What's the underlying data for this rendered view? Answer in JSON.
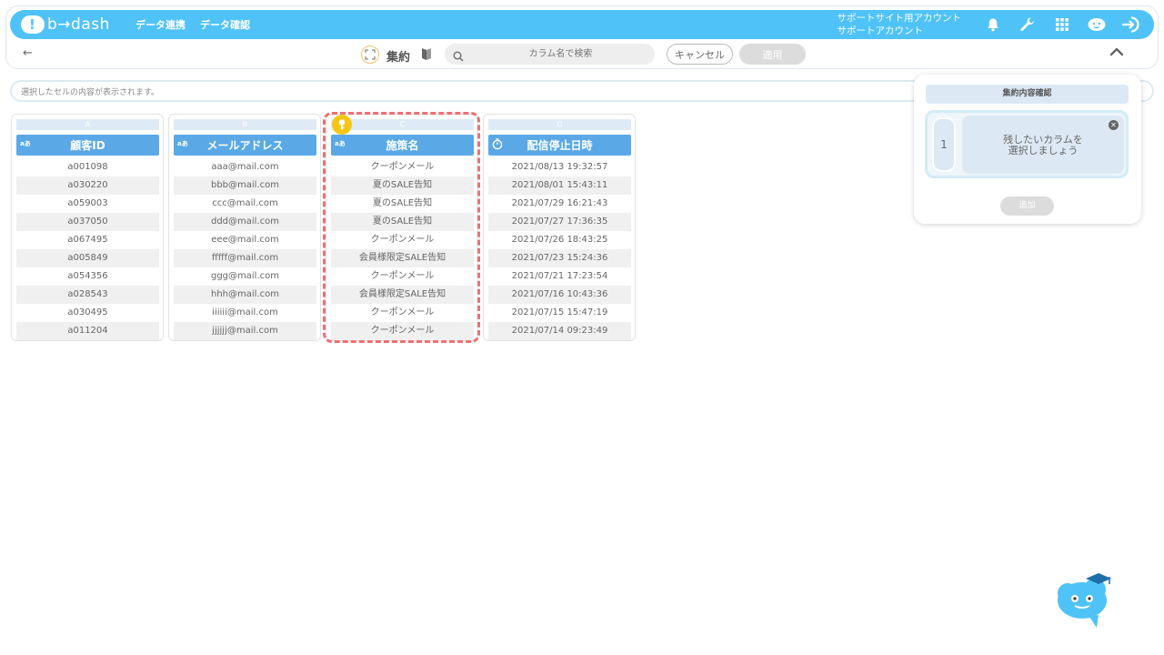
{
  "nav": {
    "logo_text": "b→dash",
    "links": [
      "データ連携",
      "データ確認"
    ],
    "account_line1": "サポートサイト用アカウント",
    "account_line2": "サポートアカウント",
    "icons": [
      "bell-icon",
      "wrench-icon",
      "grid-icon",
      "user-icon",
      "logout-icon"
    ],
    "brand_color": "#4fc3f7"
  },
  "toolbar": {
    "title": "集約",
    "search_placeholder": "カラム名で検索",
    "cancel_label": "キャンセル",
    "apply_label": "適用"
  },
  "cellbar": {
    "placeholder": "選択したセルの内容が表示されます。"
  },
  "columns": [
    {
      "letter": "A",
      "type": "aあ",
      "name": "顧客ID",
      "values": [
        "a001098",
        "a030220",
        "a059003",
        "a037050",
        "a067495",
        "a005849",
        "a054356",
        "a028543",
        "a030495",
        "a011204"
      ]
    },
    {
      "letter": "B",
      "type": "aあ",
      "name": "メールアドレス",
      "values": [
        "aaa@mail.com",
        "bbb@mail.com",
        "ccc@mail.com",
        "ddd@mail.com",
        "eee@mail.com",
        "fffff@mail.com",
        "ggg@mail.com",
        "hhh@mail.com",
        "iiiiii@mail.com",
        "jjjjjj@mail.com"
      ]
    },
    {
      "letter": "C",
      "type": "aあ",
      "name": "施策名",
      "highlighted": true,
      "values": [
        "クーポンメール",
        "夏のSALE告知",
        "夏のSALE告知",
        "夏のSALE告知",
        "クーポンメール",
        "会員様限定SALE告知",
        "クーポンメール",
        "会員様限定SALE告知",
        "クーポンメール",
        "クーポンメール"
      ]
    },
    {
      "letter": "D",
      "type": "clock",
      "name": "配信停止日時",
      "values": [
        "2021/08/13 19:32:57",
        "2021/08/01 15:43:11",
        "2021/07/29 16:21:43",
        "2021/07/27 17:36:35",
        "2021/07/26 18:43:25",
        "2021/07/23 15:24:36",
        "2021/07/21 17:23:54",
        "2021/07/16 10:43:36",
        "2021/07/15 15:47:19",
        "2021/07/14 09:23:49"
      ]
    }
  ],
  "panel": {
    "title": "集約内容確認",
    "group_number": "1",
    "drop_line1": "残したいカラムを",
    "drop_line2": "選択しましょう",
    "add_label": "追加"
  }
}
